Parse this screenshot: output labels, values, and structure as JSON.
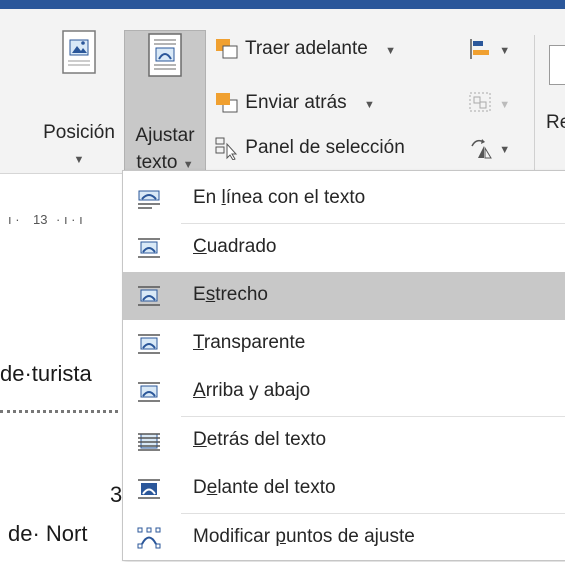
{
  "ribbon": {
    "position": {
      "label": "Posición",
      "icon": "position-icon"
    },
    "wrap_text": {
      "label_line1": "Ajustar",
      "label_line2": "texto",
      "icon": "wrap-text-icon"
    },
    "bring_forward": {
      "label": "Traer adelante",
      "icon": "bring-forward-icon"
    },
    "send_backward": {
      "label": "Enviar atrás",
      "icon": "send-backward-icon"
    },
    "selection_pane": {
      "label": "Panel de selección",
      "icon": "selection-pane-icon"
    },
    "partial_label": "Re"
  },
  "ruler": {
    "label": "13"
  },
  "document": {
    "line1": "de·turista",
    "line2": "3",
    "line3": "de· Nort"
  },
  "menu": {
    "items": [
      {
        "pre": "En ",
        "key": "l",
        "post": "ínea con el texto",
        "icon": "inline-with-text-icon"
      },
      {
        "pre": "",
        "key": "C",
        "post": "uadrado",
        "icon": "square-wrap-icon"
      },
      {
        "pre": "E",
        "key": "s",
        "post": "trecho",
        "icon": "tight-wrap-icon"
      },
      {
        "pre": "",
        "key": "T",
        "post": "ransparente",
        "icon": "through-wrap-icon"
      },
      {
        "pre": "",
        "key": "A",
        "post": "rriba y abajo",
        "icon": "top-bottom-wrap-icon"
      },
      {
        "pre": "",
        "key": "D",
        "post": "etrás del texto",
        "icon": "behind-text-icon"
      },
      {
        "pre": "D",
        "key": "e",
        "post": "lante del texto",
        "icon": "in-front-of-text-icon"
      },
      {
        "pre": "Modificar ",
        "key": "p",
        "post": "untos de ajuste",
        "icon": "edit-wrap-points-icon"
      }
    ]
  }
}
